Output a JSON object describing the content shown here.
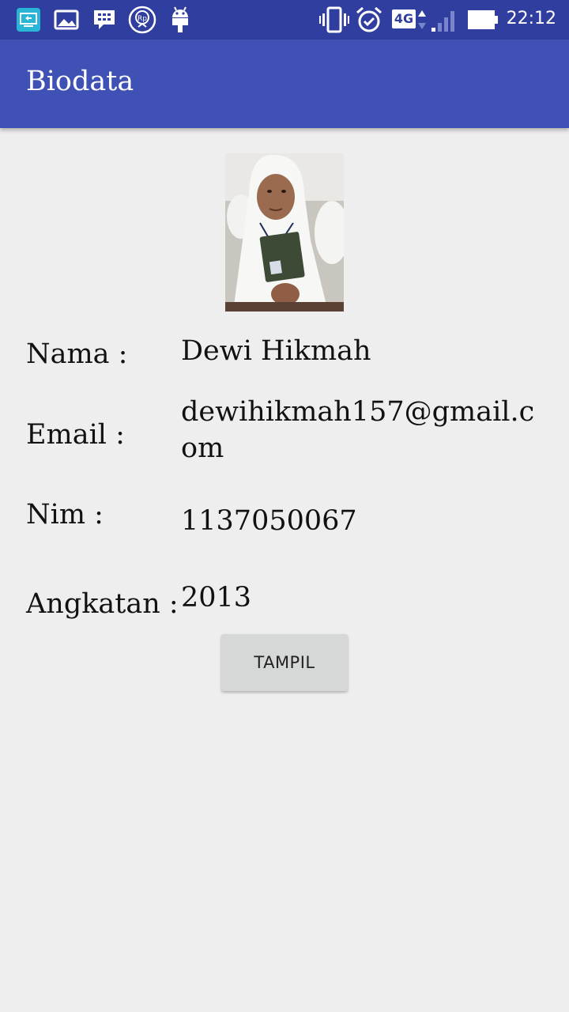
{
  "status_bar": {
    "time": "22:12",
    "network": "4G",
    "icons": [
      "screen-mirror-icon",
      "gallery-icon",
      "bbm-icon",
      "rupiah-app-icon",
      "android-icon",
      "vibrate-icon",
      "alarm-icon",
      "network-4g-icon",
      "signal-icon",
      "battery-icon"
    ]
  },
  "app_bar": {
    "title": "Biodata"
  },
  "profile": {
    "fields": [
      {
        "label": "Nama :",
        "value": "Dewi Hikmah"
      },
      {
        "label": "Email :",
        "value": "dewihikmah157@gmail.com"
      },
      {
        "label": "Nim :",
        "value": "1137050067"
      },
      {
        "label": "Angkatan :",
        "value": "2013"
      }
    ]
  },
  "button": {
    "label": "TAMPIL"
  },
  "colors": {
    "status_bar": "#303f9f",
    "app_bar": "#3f51b5",
    "background": "#eeeeee",
    "button": "#d6d7d7"
  }
}
